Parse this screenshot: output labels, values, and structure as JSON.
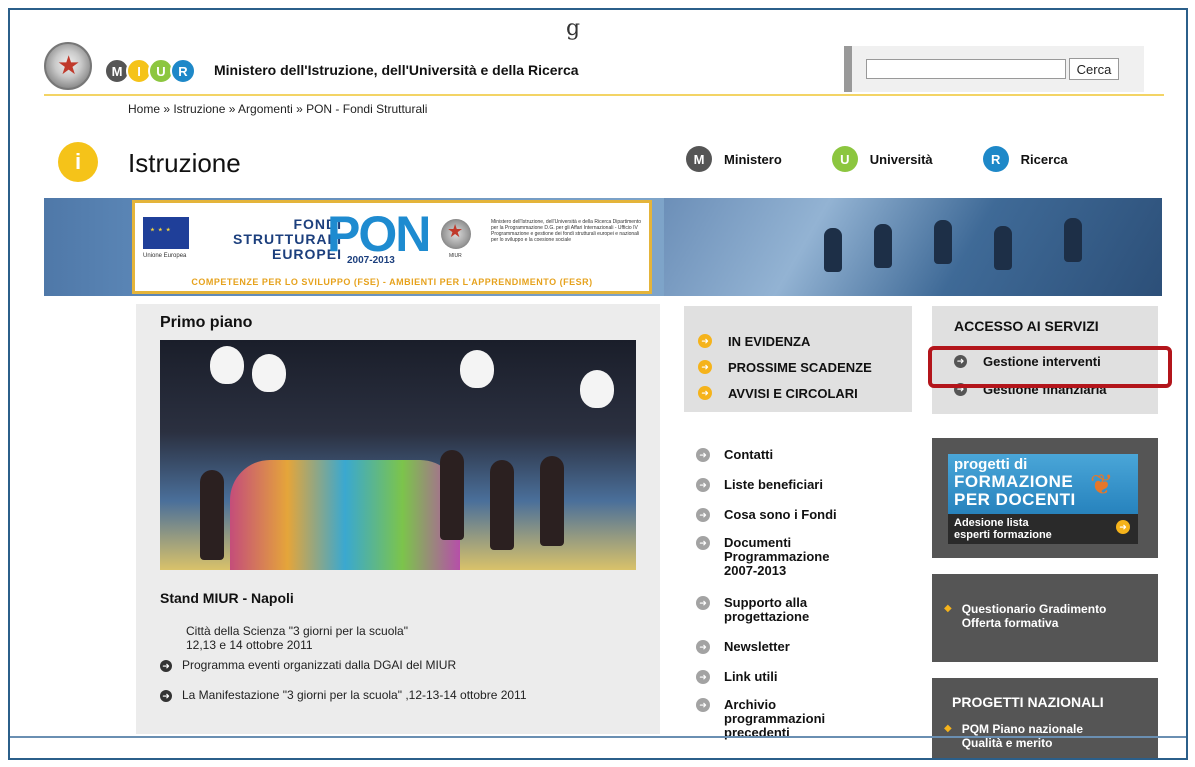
{
  "header": {
    "top_glyph": "g",
    "logo_letters": [
      "M",
      "I",
      "U",
      "R"
    ],
    "ministry_title": "Ministero dell'Istruzione, dell'Università e della Ricerca",
    "search_placeholder": "",
    "search_button": "Cerca"
  },
  "breadcrumb": "Home » Istruzione » Argomenti » PON - Fondi Strutturali",
  "section": {
    "icon_letter": "i",
    "title": "Istruzione",
    "nav": [
      {
        "letter": "M",
        "label": "Ministero",
        "color": "#555555"
      },
      {
        "letter": "U",
        "label": "Università",
        "color": "#8cc63f"
      },
      {
        "letter": "R",
        "label": "Ricerca",
        "color": "#1e88c8"
      }
    ]
  },
  "banner": {
    "eu_label": "Unione Europea",
    "fondi_lines": [
      "FONDI",
      "STRUTTURALI",
      "EUROPEI"
    ],
    "pon": "PON",
    "pon_years": "2007-2013",
    "miur_small": "MIUR",
    "ministry_small": "Ministero dell'Istruzione, dell'Università e della Ricerca Dipartimento per la Programmazione D.G. per gli Affari Internazionali - Ufficio IV Programmazione e gestione dei fondi strutturali europei e nazionali per lo sviluppo e la coesione sociale",
    "strip": "COMPETENZE PER LO SVILUPPO (FSE) - AMBIENTI PER L'APPRENDIMENTO (FESR)"
  },
  "primo": {
    "title": "Primo piano",
    "stand_title": "Stand MIUR - Napoli",
    "line1": "Città della Scienza \"3 giorni per la scuola\"",
    "line2": "12,13 e 14 ottobre 2011",
    "link1": "Programma eventi organizzati dalla DGAI del MIUR",
    "link2": "La Manifestazione \"3 giorni per la scuola\" ,12-13-14 ottobre 2011"
  },
  "evidenza": [
    "IN EVIDENZA",
    "PROSSIME SCADENZE",
    "AVVISI E CIRCOLARI"
  ],
  "links": [
    [
      "Contatti"
    ],
    [
      "Liste beneficiari"
    ],
    [
      "Cosa sono i Fondi"
    ],
    [
      "Documenti",
      "Programmazione",
      "2007-2013"
    ],
    [
      "Supporto alla",
      "progettazione"
    ],
    [
      "Newsletter"
    ],
    [
      "Link utili"
    ],
    [
      "Archivio",
      "programmazioni",
      "precedenti"
    ]
  ],
  "services": {
    "title": "ACCESSO AI SERVIZI",
    "items": [
      "Gestione interventi",
      "Gestione finanziaria"
    ]
  },
  "promo": {
    "line1": "progetti di",
    "line2": "FORMAZIONE",
    "line3": "PER DOCENTI",
    "sub1": "Adesione lista",
    "sub2": "esperti formazione"
  },
  "quest": {
    "line1": "Questionario Gradimento",
    "line2": "Offerta formativa"
  },
  "nazionali": {
    "title": "PROGETTI NAZIONALI",
    "line1": "PQM Piano nazionale",
    "line2": "Qualità e merito"
  },
  "colors": {
    "logo": [
      "#555555",
      "#f5c319",
      "#8cc63f",
      "#1e88c8"
    ],
    "accent_yellow": "#f5b31b",
    "highlight_red": "#b3151b",
    "frame_blue": "#2b5f8a"
  }
}
